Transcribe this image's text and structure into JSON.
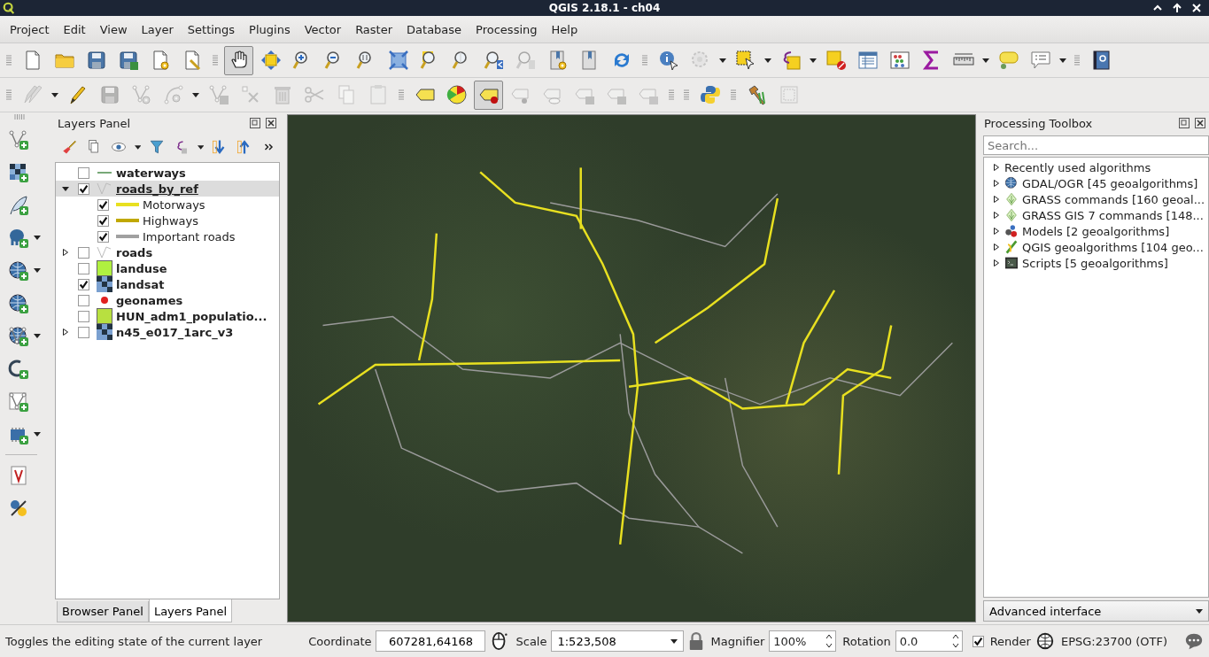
{
  "window": {
    "title": "QGIS 2.18.1 - ch04"
  },
  "menu": [
    "Project",
    "Edit",
    "View",
    "Layer",
    "Settings",
    "Plugins",
    "Vector",
    "Raster",
    "Database",
    "Processing",
    "Help"
  ],
  "toolbars": [
    {
      "tools": [
        {
          "kind": "grip"
        },
        {
          "kind": "new-project",
          "selected": false,
          "disabled": false
        },
        {
          "kind": "open-project",
          "selected": false,
          "disabled": false
        },
        {
          "kind": "save-project",
          "selected": false,
          "disabled": false
        },
        {
          "kind": "save-as",
          "selected": false,
          "disabled": false
        },
        {
          "kind": "new-layout",
          "selected": false,
          "disabled": false
        },
        {
          "kind": "layout-manager",
          "selected": false,
          "disabled": false
        },
        {
          "kind": "grip"
        },
        {
          "kind": "pan",
          "selected": true,
          "disabled": false
        },
        {
          "kind": "pan-to-selection",
          "selected": false,
          "disabled": false
        },
        {
          "kind": "zoom-in",
          "selected": false,
          "disabled": false
        },
        {
          "kind": "zoom-out",
          "selected": false,
          "disabled": false
        },
        {
          "kind": "zoom-native",
          "selected": false,
          "disabled": false
        },
        {
          "kind": "zoom-full",
          "selected": false,
          "disabled": false
        },
        {
          "kind": "zoom-layer",
          "selected": false,
          "disabled": false
        },
        {
          "kind": "zoom-selection",
          "selected": false,
          "disabled": false
        },
        {
          "kind": "zoom-last",
          "selected": false,
          "disabled": false
        },
        {
          "kind": "zoom-next",
          "selected": false,
          "disabled": true
        },
        {
          "kind": "new-bookmark",
          "selected": false,
          "disabled": false
        },
        {
          "kind": "bookmarks",
          "selected": false,
          "disabled": false
        },
        {
          "kind": "refresh",
          "selected": false,
          "disabled": false
        },
        {
          "kind": "grip"
        },
        {
          "kind": "identify",
          "selected": false,
          "disabled": false
        },
        {
          "kind": "run-action",
          "selected": false,
          "disabled": true,
          "menu": true
        },
        {
          "kind": "select",
          "selected": false,
          "disabled": false,
          "menu": true
        },
        {
          "kind": "select-expression",
          "selected": false,
          "disabled": false,
          "menu": true
        },
        {
          "kind": "deselect",
          "selected": false,
          "disabled": false
        },
        {
          "kind": "attribute-table",
          "selected": false,
          "disabled": false
        },
        {
          "kind": "statistics",
          "selected": false,
          "disabled": false
        },
        {
          "kind": "sum",
          "selected": false,
          "disabled": false
        },
        {
          "kind": "measure",
          "selected": false,
          "disabled": false,
          "menu": true
        },
        {
          "kind": "annotation",
          "selected": false,
          "disabled": false
        },
        {
          "kind": "map-tips",
          "selected": false,
          "disabled": false,
          "menu": true
        },
        {
          "kind": "grip"
        },
        {
          "kind": "help",
          "selected": false,
          "disabled": false
        }
      ]
    },
    {
      "tools": [
        {
          "kind": "grip"
        },
        {
          "kind": "current-edits",
          "selected": false,
          "disabled": true,
          "menu": true
        },
        {
          "kind": "toggle-editing",
          "selected": false,
          "disabled": false
        },
        {
          "kind": "save-edits",
          "selected": false,
          "disabled": true
        },
        {
          "kind": "add-feature",
          "selected": false,
          "disabled": true
        },
        {
          "kind": "add-curve",
          "selected": false,
          "disabled": true,
          "menu": true
        },
        {
          "kind": "move-feature",
          "selected": false,
          "disabled": true
        },
        {
          "kind": "node-tool",
          "selected": false,
          "disabled": true
        },
        {
          "kind": "delete",
          "selected": false,
          "disabled": true
        },
        {
          "kind": "cut",
          "selected": false,
          "disabled": true
        },
        {
          "kind": "copy",
          "selected": false,
          "disabled": true
        },
        {
          "kind": "paste",
          "selected": false,
          "disabled": true
        },
        {
          "kind": "grip"
        },
        {
          "kind": "label",
          "selected": false,
          "disabled": false
        },
        {
          "kind": "diagram",
          "selected": false,
          "disabled": false
        },
        {
          "kind": "pin-label",
          "selected": true,
          "disabled": false
        },
        {
          "kind": "show-pins",
          "selected": false,
          "disabled": true
        },
        {
          "kind": "show-hide-label",
          "selected": false,
          "disabled": true
        },
        {
          "kind": "move-label",
          "selected": false,
          "disabled": true
        },
        {
          "kind": "rotate-label",
          "selected": false,
          "disabled": true
        },
        {
          "kind": "change-label",
          "selected": false,
          "disabled": true
        },
        {
          "kind": "grip"
        },
        {
          "kind": "grip"
        },
        {
          "kind": "python",
          "selected": false,
          "disabled": false
        },
        {
          "kind": "grip"
        },
        {
          "kind": "hammer",
          "selected": false,
          "disabled": false
        },
        {
          "kind": "layout-tool",
          "selected": false,
          "disabled": true
        }
      ]
    }
  ],
  "side_toolbar": [
    {
      "kind": "grip"
    },
    {
      "kind": "add-vector"
    },
    {
      "kind": "add-raster"
    },
    {
      "kind": "add-delimited"
    },
    {
      "kind": "add-postgis",
      "menu": true
    },
    {
      "kind": "add-wms",
      "menu": true
    },
    {
      "kind": "add-wcs"
    },
    {
      "kind": "add-wfs",
      "menu": true
    },
    {
      "kind": "add-spatialite"
    },
    {
      "kind": "add-virtual"
    },
    {
      "kind": "add-gps",
      "menu": true
    },
    {
      "kind": "divider"
    },
    {
      "kind": "grass"
    },
    {
      "kind": "georef"
    }
  ],
  "layers_panel": {
    "title": "Layers Panel",
    "tools": [
      {
        "kind": "style"
      },
      {
        "kind": "add-group"
      },
      {
        "kind": "eye",
        "menu": true
      },
      {
        "kind": "filter"
      },
      {
        "kind": "expression",
        "menu": true
      },
      {
        "kind": "expand-all"
      },
      {
        "kind": "collapse-all"
      },
      {
        "kind": "more"
      }
    ],
    "layers": [
      {
        "name": "waterways",
        "checked": false,
        "selected": false,
        "kind": "line",
        "color": "#78a878"
      },
      {
        "name": "roads_by_ref",
        "checked": true,
        "selected": true,
        "expanded": true,
        "kind": "vector",
        "children": [
          {
            "name": "Motorways",
            "checked": true,
            "color": "#e8e020"
          },
          {
            "name": "Highways",
            "checked": true,
            "color": "#c0a800"
          },
          {
            "name": "Important roads",
            "checked": true,
            "color": "#a0a0a0"
          }
        ]
      },
      {
        "name": "roads",
        "checked": false,
        "selected": false,
        "expanded": false,
        "kind": "vector"
      },
      {
        "name": "landuse",
        "checked": false,
        "selected": false,
        "kind": "fill",
        "color": "#b0f040"
      },
      {
        "name": "landsat",
        "checked": true,
        "selected": false,
        "kind": "raster"
      },
      {
        "name": "geonames",
        "checked": false,
        "selected": false,
        "kind": "point",
        "color": "#e02020"
      },
      {
        "name": "HUN_adm1_populatio...",
        "checked": false,
        "selected": false,
        "kind": "fill",
        "color": "#b8e040"
      },
      {
        "name": "n45_e017_1arc_v3",
        "checked": false,
        "selected": false,
        "expanded": false,
        "kind": "raster"
      }
    ],
    "tabs": [
      {
        "label": "Browser Panel",
        "selected": false
      },
      {
        "label": "Layers Panel",
        "selected": true
      }
    ]
  },
  "processing_toolbox": {
    "title": "Processing Toolbox",
    "search": {
      "placeholder": "Search..."
    },
    "groups": [
      {
        "label": "Recently used algorithms",
        "kind": "recent"
      },
      {
        "label": "GDAL/OGR [45 geoalgorithms]",
        "kind": "gdal"
      },
      {
        "label": "GRASS commands [160 geoal...",
        "kind": "grass"
      },
      {
        "label": "GRASS GIS 7 commands [148...",
        "kind": "grass"
      },
      {
        "label": "Models [2 geoalgorithms]",
        "kind": "models"
      },
      {
        "label": "QGIS geoalgorithms [104 geo...",
        "kind": "qgis"
      },
      {
        "label": "Scripts [5 geoalgorithms]",
        "kind": "scripts"
      }
    ],
    "interface": "Advanced interface"
  },
  "status_bar": {
    "message": "Toggles the editing state of the current layer",
    "coordinate_label": "Coordinate",
    "coordinate": "607281,64168",
    "scale_label": "Scale",
    "scale": "1:523,508",
    "magnifier_label": "Magnifier",
    "magnifier": "100%",
    "rotation_label": "Rotation",
    "rotation": "0.0",
    "render": {
      "label": "Render",
      "checked": true
    },
    "crs": "EPSG:23700 (OTF)"
  }
}
